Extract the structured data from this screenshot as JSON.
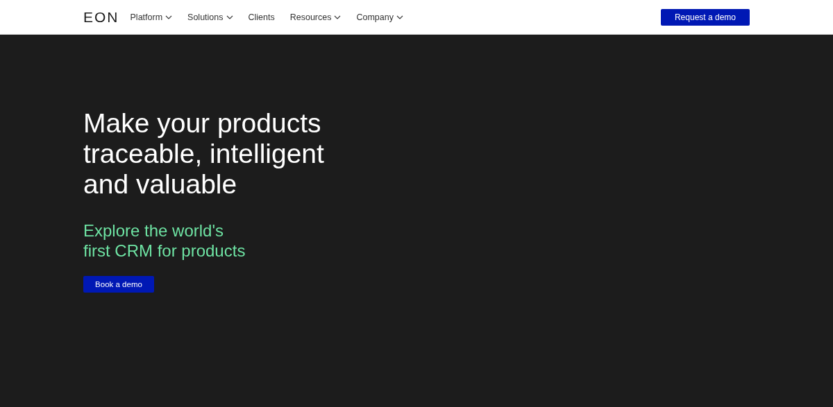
{
  "header": {
    "logo": "EON",
    "nav": [
      {
        "label": "Platform",
        "dropdown": true
      },
      {
        "label": "Solutions",
        "dropdown": true
      },
      {
        "label": "Clients",
        "dropdown": false
      },
      {
        "label": "Resources",
        "dropdown": true
      },
      {
        "label": "Company",
        "dropdown": true
      }
    ],
    "cta": "Request a demo"
  },
  "hero": {
    "headline_lines": [
      "Make your products",
      "traceable, intelligent",
      "and valuable"
    ],
    "subheadline_lines": [
      "Explore the world's",
      "first CRM for products"
    ],
    "button": "Book a demo"
  }
}
